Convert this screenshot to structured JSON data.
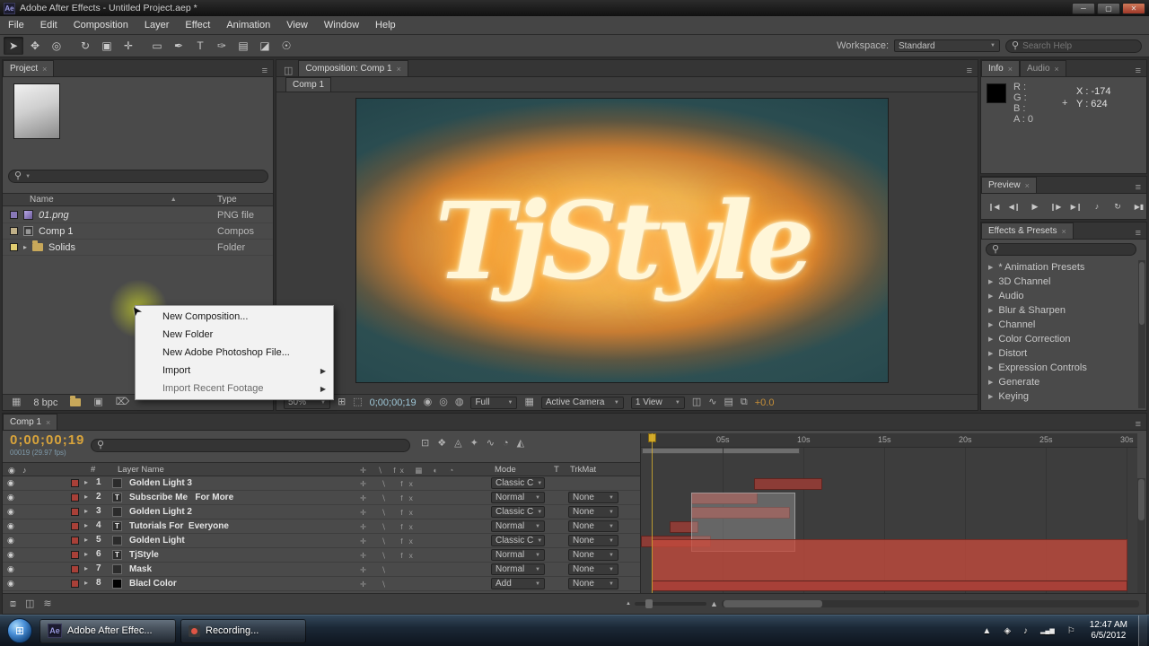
{
  "ui": {
    "panel_menu_icon": "≡",
    "close_icon": "×",
    "caret": "▼",
    "arrow_right": "▶",
    "expander": "▸",
    "sort_arrow": "▲",
    "magnifier": "⚲",
    "eye_icon": "◉",
    "audio_icon": "♪",
    "crosshair": "+",
    "grip_icon": "◫",
    "hash": "#"
  },
  "title_bar": {
    "app_icon": "Ae",
    "title": "Adobe After Effects - Untitled Project.aep *",
    "minimize_icon": "─",
    "maximize_icon": "▢",
    "close_icon": "✕"
  },
  "menu_bar": {
    "items": [
      "File",
      "Edit",
      "Composition",
      "Layer",
      "Effect",
      "Animation",
      "View",
      "Window",
      "Help"
    ]
  },
  "toolbar": {
    "tools": [
      {
        "glyph": "➤"
      },
      {
        "glyph": "✥"
      },
      {
        "glyph": "◎"
      },
      {
        "glyph": "↻"
      },
      {
        "glyph": "▣"
      },
      {
        "glyph": "✛"
      },
      {
        "glyph": "▭"
      },
      {
        "glyph": "✒"
      },
      {
        "glyph": "T"
      },
      {
        "glyph": "✑"
      },
      {
        "glyph": "▤"
      },
      {
        "glyph": "◪"
      },
      {
        "glyph": "☉"
      }
    ],
    "workspace_label": "Workspace:",
    "workspace_value": "Standard",
    "search_placeholder": "Search Help"
  },
  "project_panel": {
    "tab_label": "Project",
    "name_column": "Name",
    "type_column": "Type",
    "items": [
      {
        "label_color": "#8878b8",
        "name": "01.png",
        "type": "PNG file"
      },
      {
        "label_color": "#c0b088",
        "name": "Comp 1",
        "type": "Compos"
      },
      {
        "label_color": "#e0cc70",
        "name": "Solids",
        "type": "Folder"
      }
    ],
    "bpc": "8 bpc",
    "trash_icon": "⌦",
    "flowchart_icon": "▦",
    "comp_icon": "▣"
  },
  "context_menu": {
    "items": [
      {
        "label": "New Composition..."
      },
      {
        "label": "New Folder"
      },
      {
        "label": "New Adobe Photoshop File..."
      },
      {
        "label": "Import"
      },
      {
        "label": "Import Recent Footage"
      }
    ]
  },
  "composition_panel": {
    "tab_label": "Composition: Comp 1",
    "sub_tab": "Comp 1",
    "canvas_text": "TjStyle",
    "footer": {
      "zoom": "50%",
      "time": "0;00;00;19",
      "resolution": "Full",
      "camera": "Active Camera",
      "view": "1 View",
      "exposure": "+0.0",
      "icons": [
        {
          "glyph": "⊞"
        },
        {
          "glyph": "⬚"
        },
        {
          "glyph": "◉"
        },
        {
          "glyph": "◎"
        },
        {
          "glyph": "◍"
        },
        {
          "glyph": "▦"
        },
        {
          "glyph": "◫"
        },
        {
          "glyph": "∿"
        },
        {
          "glyph": "▤"
        },
        {
          "glyph": "⧉"
        }
      ]
    }
  },
  "info_panel": {
    "tab_info": "Info",
    "tab_audio": "Audio",
    "r_label": "R :",
    "g_label": "G :",
    "b_label": "B :",
    "a_label": "A : 0",
    "x_value": "X : -174",
    "y_value": "Y : 624"
  },
  "preview_panel": {
    "tab_label": "Preview",
    "buttons": [
      {
        "glyph": "❙◀"
      },
      {
        "glyph": "◀❙"
      },
      {
        "glyph": "▶"
      },
      {
        "glyph": "❙▶"
      },
      {
        "glyph": "▶❙"
      },
      {
        "glyph": "♪"
      },
      {
        "glyph": "↻"
      },
      {
        "glyph": "▶▮"
      }
    ]
  },
  "effects_panel": {
    "tab_label": "Effects & Presets",
    "items": [
      "* Animation Presets",
      "3D Channel",
      "Audio",
      "Blur & Sharpen",
      "Channel",
      "Color Correction",
      "Distort",
      "Expression Controls",
      "Generate",
      "Keying"
    ]
  },
  "timeline": {
    "tab_label": "Comp 1",
    "time_display": "0;00;00;19",
    "frame_info": "00019 (29.97 fps)",
    "layer_name_column": "Layer Name",
    "mode_column": "Mode",
    "t_column": "T",
    "trkmat_column": "TrkMat",
    "header_switches": "✛ ∖ fx ▦ ◐ ◔",
    "header_icons": [
      {
        "glyph": "⊡"
      },
      {
        "glyph": "❖"
      },
      {
        "glyph": "◬"
      },
      {
        "glyph": "✦"
      },
      {
        "glyph": "∿"
      },
      {
        "glyph": "◔"
      },
      {
        "glyph": "◭"
      }
    ],
    "layers": [
      {
        "num": "1",
        "icon": "",
        "name": "Golden Light 3",
        "switches": "✛ ∖ fx",
        "mode": "Classic C",
        "trkmat": "",
        "label_color": "#a84038"
      },
      {
        "num": "2",
        "icon": "T",
        "name": "Subscribe Me   For More",
        "switches": "✛ ∖ fx",
        "mode": "Normal",
        "trkmat": "None",
        "label_color": "#a84038"
      },
      {
        "num": "3",
        "icon": "",
        "name": "Golden Light 2",
        "switches": "✛ ∖ fx",
        "mode": "Classic C",
        "trkmat": "None",
        "label_color": "#a84038"
      },
      {
        "num": "4",
        "icon": "T",
        "name": "Tutorials For  Everyone",
        "switches": "✛ ∖ fx",
        "mode": "Normal",
        "trkmat": "None",
        "label_color": "#a84038"
      },
      {
        "num": "5",
        "icon": "",
        "name": "Golden Light",
        "switches": "✛ ∖ fx",
        "mode": "Classic C",
        "trkmat": "None",
        "label_color": "#a84038"
      },
      {
        "num": "6",
        "icon": "T",
        "name": "TjStyle",
        "switches": "✛ ∖ fx",
        "mode": "Normal",
        "trkmat": "None",
        "label_color": "#a84038"
      },
      {
        "num": "7",
        "icon": "",
        "name": "Mask",
        "switches": "✛ ∖",
        "mode": "Normal",
        "trkmat": "None",
        "label_color": "#a84038"
      },
      {
        "num": "8",
        "icon": "",
        "name": "Blacl Color",
        "switches": "✛ ∖",
        "mode": "Add",
        "trkmat": "None",
        "label_color": "#a84038"
      }
    ],
    "ruler_labels": [
      "05s",
      "10s",
      "15s",
      "20s",
      "25s",
      "30s"
    ],
    "footer_icons": [
      {
        "glyph": "⧈"
      },
      {
        "glyph": "◫"
      },
      {
        "glyph": "≋"
      }
    ]
  },
  "taskbar": {
    "start_icon": "⊞",
    "apps": [
      {
        "icon": "Ae",
        "label": "Adobe After Effec..."
      },
      {
        "label": "Recording..."
      }
    ],
    "tray_icons": [
      {
        "glyph": "▲"
      },
      {
        "glyph": "◈"
      },
      {
        "glyph": "♪"
      },
      {
        "glyph": "▂▄▆"
      },
      {
        "glyph": "⚐"
      }
    ],
    "clock_time": "12:47 AM",
    "clock_date": "6/5/2012"
  }
}
